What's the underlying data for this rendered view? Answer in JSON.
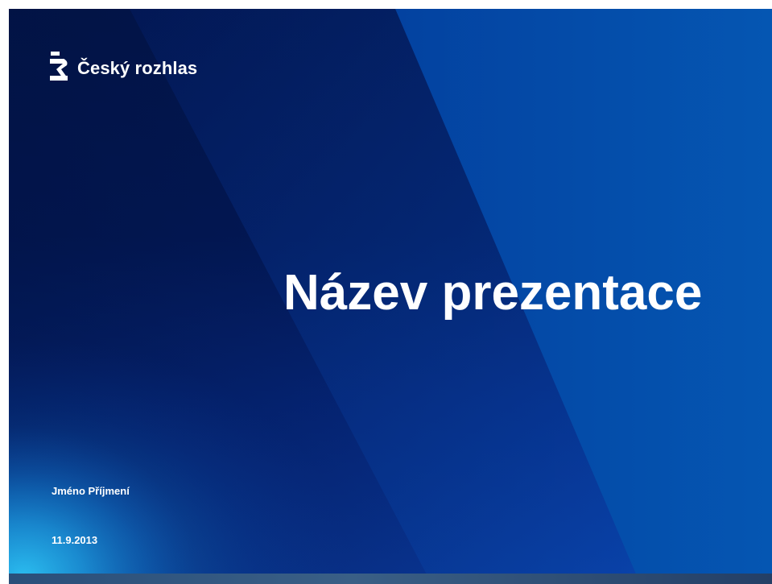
{
  "slide": {
    "logo": {
      "icon": "cesky-rozhlas-logo-icon",
      "text": "Český rozhlas"
    },
    "title": "Název prezentace",
    "author": "Jméno Příjmení",
    "date": "11.9.2013"
  },
  "colors": {
    "background_dark": "#02174f",
    "background_mid": "#0a3a9f",
    "background_bright": "#0450a8",
    "accent_light_blue": "#1ea7e8",
    "text": "#ffffff"
  }
}
